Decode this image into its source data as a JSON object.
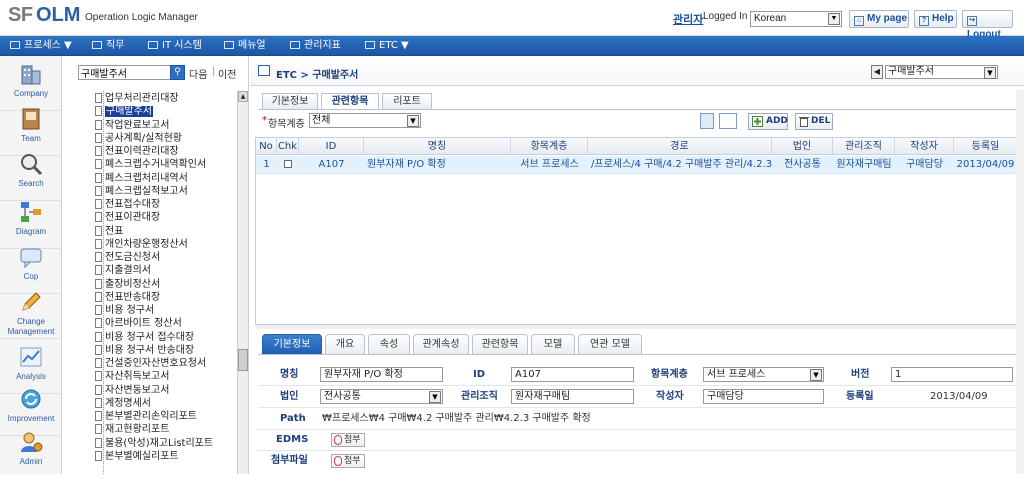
{
  "header": {
    "logo_sf": "SF",
    "logo_olm": "OLM",
    "logo_sub": "Operation Logic Manager",
    "user": "관리자",
    "logged_in": "Logged In",
    "language": "Korean",
    "mypage": "My page",
    "help": "Help",
    "logout": "Logout"
  },
  "nav": {
    "items": [
      "프로세스",
      "직무",
      "IT 시스템",
      "메뉴얼",
      "관리지표",
      "ETC"
    ]
  },
  "sidebar": {
    "items": [
      {
        "label": "Company",
        "icon": "building-icon"
      },
      {
        "label": "Team",
        "icon": "book-icon"
      },
      {
        "label": "Search",
        "icon": "magnifier-icon"
      },
      {
        "label": "Diagram",
        "icon": "flowchart-icon"
      },
      {
        "label": "Cop",
        "icon": "chat-icon"
      },
      {
        "label": "Change Management",
        "icon": "pencil-icon"
      },
      {
        "label": "Analysis",
        "icon": "chart-icon"
      },
      {
        "label": "Improvement",
        "icon": "cycle-icon"
      },
      {
        "label": "Admin",
        "icon": "admin-icon"
      }
    ]
  },
  "tree": {
    "search_value": "구매발주서",
    "next": "다음",
    "sep": "|",
    "prev": "이전",
    "items": [
      "업무처리관리대장",
      "구매발주서",
      "작업완료보고서",
      "공사계획/실적현황",
      "전표이력관리대장",
      "폐스크랩수거내역확인서",
      "폐스크랩처리내역서",
      "폐스크랩실적보고서",
      "전표접수대장",
      "전표이관대장",
      "전표",
      "개인차량운행정산서",
      "전도금신청서",
      "지출결의서",
      "출장비정산서",
      "전표반송대장",
      "비용 청구서",
      "아르바이트 정산서",
      "비용 청구서 접수대장",
      "비용 청구서 반송대장",
      "건설중인자산변호요청서",
      "자산취득보고서",
      "자산변동보고서",
      "계정명세서",
      "본부별관리손익리포트",
      "재고현황리포트",
      "불용(악성)재고List리포트",
      "본부별예실리포트"
    ]
  },
  "content": {
    "breadcrumb": "ETC > 구매발주서",
    "nav_select": "구매발주서",
    "tabs": [
      "기본정보",
      "관련항목",
      "리포트"
    ],
    "filter_label": "항목계층",
    "filter_value": "전체",
    "add": "ADD",
    "del": "DEL",
    "grid": {
      "headers": [
        "No",
        "Chk",
        "ID",
        "명칭",
        "항목계층",
        "경로",
        "법인",
        "관리조직",
        "작성자",
        "등록일"
      ],
      "rows": [
        {
          "no": "1",
          "id": "A107",
          "name": "원부자재 P/O 확정",
          "level": "서브 프로세스",
          "path": "/프로세스/4 구매/4.2 구매발주 관리/4.2.3 구",
          "corp": "전사공통",
          "org": "원자재구매팀",
          "author": "구매담당",
          "date": "2013/04/09"
        }
      ]
    },
    "detail_tabs": [
      "기본정보",
      "개요",
      "속성",
      "관계속성",
      "관련항목",
      "모델",
      "연관 모델"
    ],
    "detail": {
      "name_lbl": "명칭",
      "name": "원부자재 P/O 확정",
      "id_lbl": "ID",
      "id": "A107",
      "level_lbl": "항목계층",
      "level": "서브 프로세스",
      "version_lbl": "버전",
      "version": "1",
      "corp_lbl": "법인",
      "corp": "전사공통",
      "org_lbl": "관리조직",
      "org": "원자재구매팀",
      "author_lbl": "작성자",
      "author": "구매담당",
      "date_lbl": "등록일",
      "date": "2013/04/09",
      "path_lbl": "Path",
      "path": "₩프로세스₩4 구매₩4.2 구매발주 관리₩4.2.3 구매발주 확정",
      "edms_lbl": "EDMS",
      "edms_btn": "첨부",
      "file_lbl": "첨부파일",
      "file_btn": "첨부"
    }
  }
}
